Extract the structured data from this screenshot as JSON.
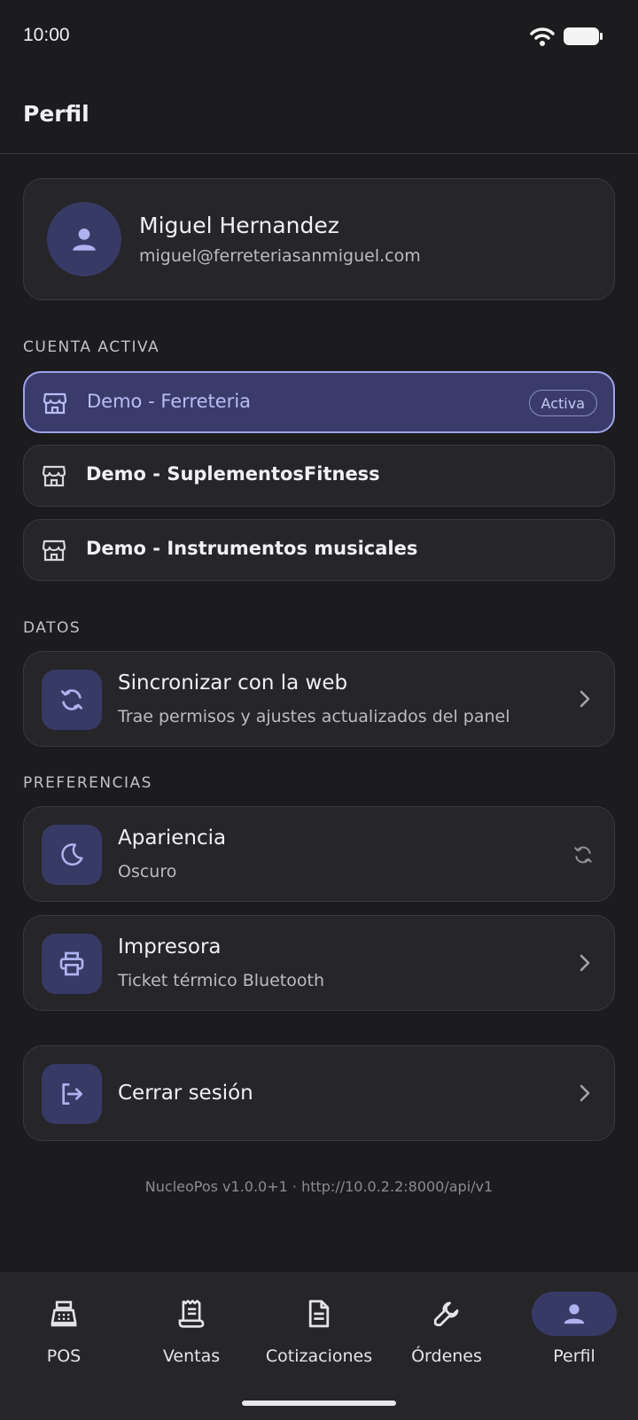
{
  "status_bar": {
    "time": "10:00",
    "icons": [
      "wifi-icon",
      "battery-icon"
    ]
  },
  "appbar": {
    "title": "Perfil"
  },
  "profile": {
    "name": "Miguel Hernandez",
    "email": "miguel@ferreteriasanmiguel.com",
    "icon": "person-icon"
  },
  "sections": {
    "account": "CUENTA ACTIVA",
    "data": "DATOS",
    "preferences": "PREFERENCIAS"
  },
  "accounts": [
    {
      "label": "Demo - Ferreteria",
      "active": true,
      "badge": "Activa"
    },
    {
      "label": "Demo - SuplementosFitness",
      "active": false
    },
    {
      "label": "Demo - Instrumentos musicales",
      "active": false
    }
  ],
  "sync": {
    "title": "Sincronizar con la web",
    "subtitle": "Trae permisos y ajustes actualizados del panel",
    "icon": "sync-icon"
  },
  "appearance": {
    "title": "Apariencia",
    "subtitle": "Oscuro",
    "icon": "moon-icon",
    "trailing_icon": "sync-icon"
  },
  "printer": {
    "title": "Impresora",
    "subtitle": "Ticket térmico Bluetooth",
    "icon": "printer-icon"
  },
  "logout": {
    "title": "Cerrar sesión",
    "icon": "logout-icon"
  },
  "footer": {
    "text": "NucleoPos v1.0.0+1  ·  http://10.0.2.2:8000/api/v1"
  },
  "nav": [
    {
      "label": "POS",
      "icon": "cash-register-icon"
    },
    {
      "label": "Ventas",
      "icon": "receipt-icon"
    },
    {
      "label": "Cotizaciones",
      "icon": "document-icon"
    },
    {
      "label": "Órdenes",
      "icon": "wrench-icon"
    },
    {
      "label": "Perfil",
      "icon": "person-icon",
      "selected": true
    }
  ],
  "colors": {
    "background": "#1c1b1d",
    "card": "#262528",
    "accent": "#383a66",
    "active_border": "#9ea4e8",
    "active_text": "#b9bdf5"
  }
}
